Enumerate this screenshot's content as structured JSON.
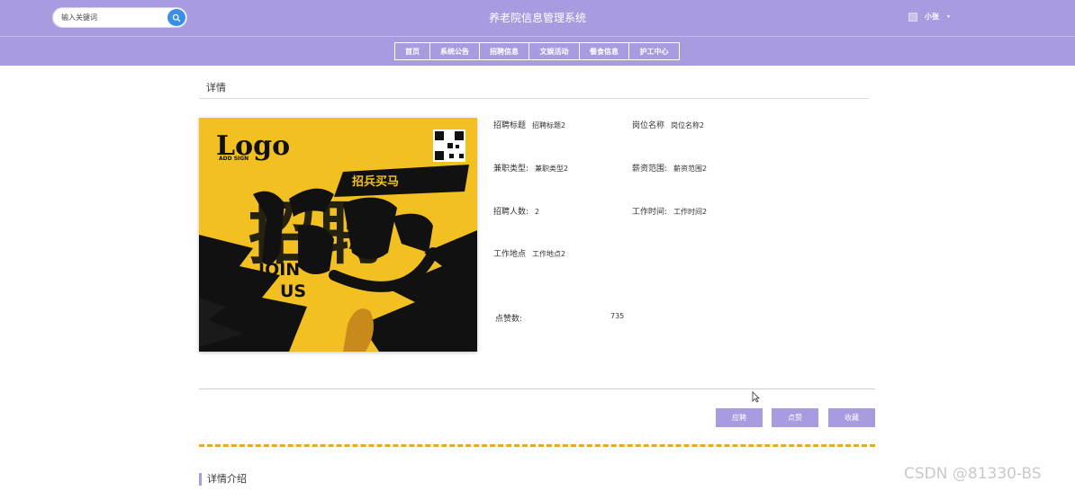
{
  "header": {
    "search_placeholder": "输入关键词",
    "site_title": "养老院信息管理系统",
    "user_name": "小张",
    "user_caret": "▾"
  },
  "nav": {
    "items": [
      "首页",
      "系统公告",
      "招聘信息",
      "文娱活动",
      "餐食信息",
      "护工中心"
    ]
  },
  "detail": {
    "heading": "详情",
    "poster": {
      "logo_text": "Logo",
      "logo_sub": "ADD SIGN",
      "badge_text": "招兵买马",
      "big_chars": "招聘",
      "join_line1": "JOIN",
      "join_line2": "US"
    },
    "fields": [
      {
        "label": "招聘标题",
        "value": "招聘标题2"
      },
      {
        "label": "岗位名称",
        "value": "岗位名称2"
      },
      {
        "label": "兼职类型:",
        "value": "兼职类型2"
      },
      {
        "label": "薪资范围:",
        "value": "薪资范围2"
      },
      {
        "label": "招聘人数:",
        "value": "2"
      },
      {
        "label": "工作时间:",
        "value": "工作时间2"
      },
      {
        "label": "工作地点",
        "value": "工作地点2"
      }
    ],
    "likes_label": "点赞数:",
    "likes_value": "735"
  },
  "buttons": {
    "apply": "应聘",
    "like": "点赞",
    "favorite": "收藏"
  },
  "intro": {
    "title": "详情介绍"
  },
  "watermark": "CSDN @81330-BS",
  "colors": {
    "header_bg": "#a99be0",
    "search_button": "#3a8ee6",
    "dash_line": "#f1a526",
    "poster_bg": "#f2c021"
  }
}
